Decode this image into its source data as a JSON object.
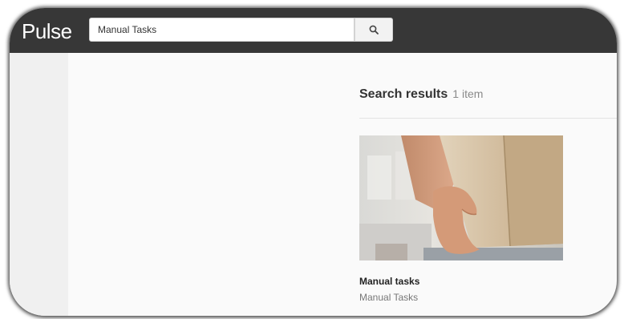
{
  "app": {
    "brand": "Pulse"
  },
  "search": {
    "value": "Manual Tasks",
    "button_icon": "search-icon"
  },
  "results": {
    "title": "Search results",
    "count": "1 item",
    "items": [
      {
        "title": "Manual tasks",
        "subtitle": "Manual Tasks",
        "image": "person-holding-cardboard-box"
      }
    ]
  },
  "colors": {
    "topbar": "#373737",
    "background": "#fafafa",
    "rail": "#f0f0f0"
  }
}
